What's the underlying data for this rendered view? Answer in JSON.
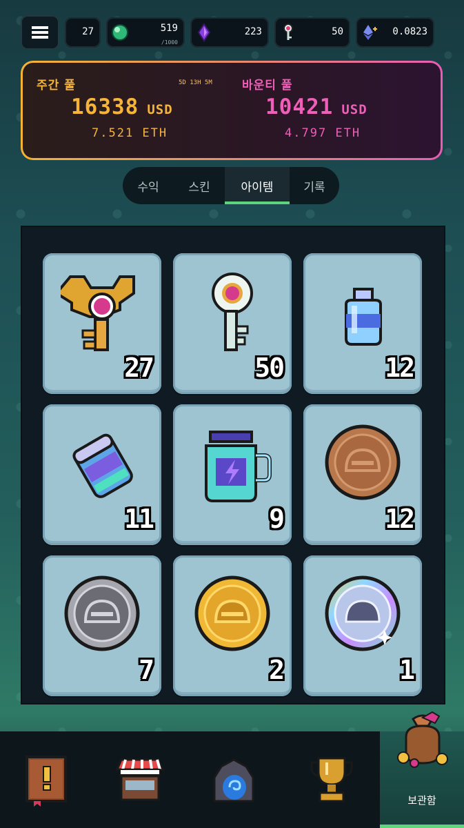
{
  "topbar": {
    "resources": [
      {
        "name": "energy",
        "icon": "energy-icon",
        "value": "27"
      },
      {
        "name": "orb",
        "icon": "green-orb-icon",
        "value": "519",
        "sub": "/1000"
      },
      {
        "name": "gem",
        "icon": "purple-gem-icon",
        "value": "223"
      },
      {
        "name": "key",
        "icon": "key-icon",
        "value": "50"
      },
      {
        "name": "eth",
        "icon": "eth-icon",
        "value": "0.0823"
      }
    ]
  },
  "pools": {
    "weekly": {
      "title": "주간 풀",
      "timer": "5D 13H 5M",
      "amount": "16338",
      "unit": "USD",
      "eth": "7.521 ETH",
      "color": "#f6b53a"
    },
    "bounty": {
      "title": "바운티 풀",
      "amount": "10421",
      "unit": "USD",
      "eth": "4.797 ETH",
      "color": "#ef5fb7"
    }
  },
  "tabs": [
    {
      "label": "수익",
      "active": false
    },
    {
      "label": "스킨",
      "active": false
    },
    {
      "label": "아이템",
      "active": true
    },
    {
      "label": "기록",
      "active": false
    }
  ],
  "inventory": [
    {
      "icon": "gold-key-icon",
      "count": "27"
    },
    {
      "icon": "silver-key-icon",
      "count": "50"
    },
    {
      "icon": "water-bottle-icon",
      "count": "12"
    },
    {
      "icon": "energy-can-icon",
      "count": "11"
    },
    {
      "icon": "energy-jar-icon",
      "count": "9"
    },
    {
      "icon": "bronze-coin-icon",
      "count": "12"
    },
    {
      "icon": "silver-coin-icon",
      "count": "7"
    },
    {
      "icon": "gold-coin-icon",
      "count": "2"
    },
    {
      "icon": "rainbow-coin-icon",
      "count": "1"
    }
  ],
  "bottom_nav": [
    {
      "icon": "quest-book-icon",
      "label": "",
      "active": false
    },
    {
      "icon": "shop-stall-icon",
      "label": "",
      "active": false
    },
    {
      "icon": "portal-icon",
      "label": "",
      "active": false
    },
    {
      "icon": "trophy-icon",
      "label": "",
      "active": false
    },
    {
      "icon": "treasure-bag-icon",
      "label": "보관함",
      "active": true
    }
  ],
  "colors": {
    "accent": "#5fd47c",
    "weekly": "#f6b53a",
    "bounty": "#ef5fb7"
  }
}
